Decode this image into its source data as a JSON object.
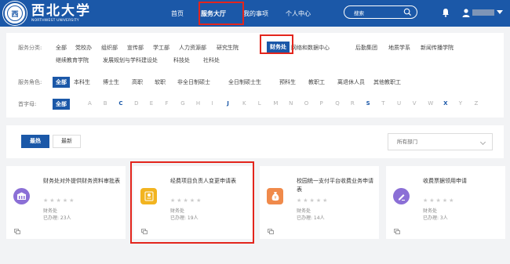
{
  "header": {
    "logo_cn": "西北大学",
    "logo_en": "NORTHWEST UNIVERSITY",
    "nav": [
      "首页",
      "服务大厅",
      "我的事项",
      "个人中心"
    ],
    "search_placeholder": "搜索"
  },
  "filter": {
    "category_label": "服务分类:",
    "categories_row1": [
      "全部",
      "党校办",
      "组织部",
      "宣传部",
      "学工部",
      "人力资源部",
      "研究生院",
      "财务处",
      "网络和数据中心",
      "后勤集团",
      "地质学系",
      "新闻传播学院"
    ],
    "categories_row2": [
      "继续教育学院",
      "发展规划与学科建设处",
      "科技处",
      "社科处"
    ],
    "selected_category": "财务处",
    "role_label": "服务角色:",
    "roles": [
      "全部",
      "本科生",
      "博士生",
      "高职",
      "软职",
      "非全日制硕士",
      "全日制硕士生",
      "预科生",
      "教职工",
      "离退休人员",
      "其他教职工"
    ],
    "letter_label": "首字母:",
    "letters_all": "全部",
    "letters": [
      "A",
      "B",
      "C",
      "D",
      "E",
      "F",
      "G",
      "H",
      "I",
      "J",
      "K",
      "L",
      "M",
      "N",
      "O",
      "P",
      "Q",
      "R",
      "S",
      "T",
      "U",
      "V",
      "W",
      "X",
      "Y",
      "Z"
    ],
    "active_letters": [
      "C",
      "J",
      "S",
      "X"
    ]
  },
  "sort": {
    "hot": "最热",
    "new": "最新",
    "dept_placeholder": "所有部门"
  },
  "cards": [
    {
      "title": "财务处对外提供财务资料审批表",
      "dept": "财务处",
      "count": "已办理: 23人",
      "icon": "building-icon",
      "color": "#8b6fd6"
    },
    {
      "title": "经费项目负责人变更申请表",
      "dept": "财务处",
      "count": "已办理: 19人",
      "icon": "badge-icon",
      "color": "#f2b420"
    },
    {
      "title": "校园统一支付平台收费业务申请表",
      "dept": "财务处",
      "count": "已办理: 14人",
      "icon": "money-bag-icon",
      "color": "#f08a4b"
    },
    {
      "title": "收费票据领用申请",
      "dept": "财务处",
      "count": "已办理: 3人",
      "icon": "edit-icon",
      "color": "#8b6fd6"
    }
  ],
  "colors": {
    "primary": "#1b58a8",
    "highlight": "#e3251c"
  }
}
